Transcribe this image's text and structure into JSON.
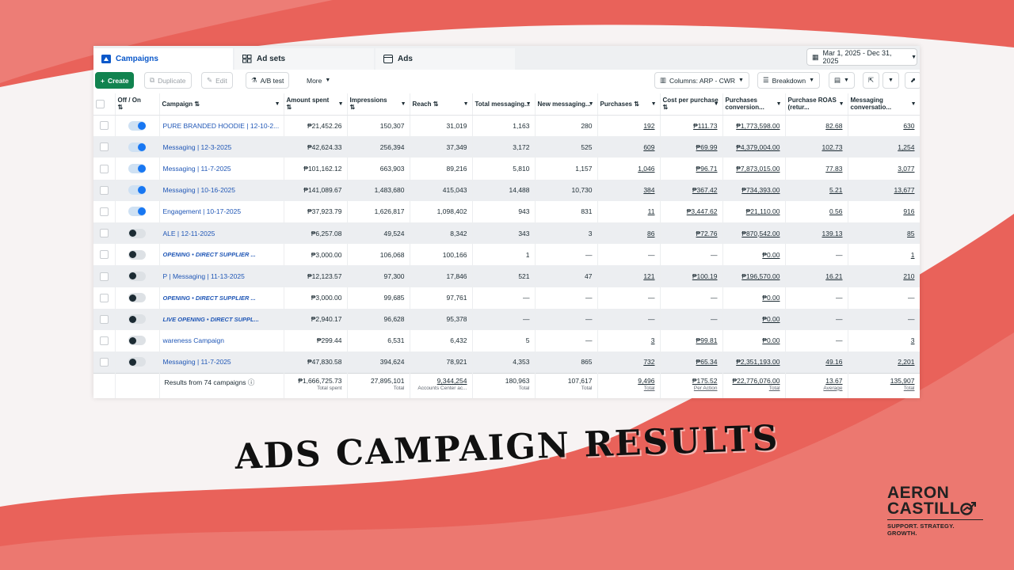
{
  "colors": {
    "accent": "#1877f2",
    "create_green": "#11834f",
    "link_blue": "#2057b6",
    "background_red": "#e8625a"
  },
  "tabs": [
    {
      "label": "Campaigns",
      "icon": "folder-icon",
      "active": true
    },
    {
      "label": "Ad sets",
      "icon": "grid-icon",
      "active": false
    },
    {
      "label": "Ads",
      "icon": "ad-card-icon",
      "active": false
    }
  ],
  "date_range": "Mar 1, 2025 - Dec 31, 2025",
  "toolbar": {
    "create": "Create",
    "duplicate": "Duplicate",
    "edit": "Edit",
    "ab_test": "A/B test",
    "more": "More",
    "columns": "Columns: ARP - CWR",
    "breakdown": "Breakdown"
  },
  "table": {
    "headers": {
      "toggle": "Off / On",
      "campaign": "Campaign",
      "amount_spent": "Amount spent",
      "impressions": "Impressions",
      "reach": "Reach",
      "total_messaging": "Total messaging...",
      "new_messaging": "New messaging...",
      "purchases": "Purchases",
      "cost_per_purchase": "Cost per purchase",
      "purchases_conversion": "Purchases conversion...",
      "purchase_roas": "Purchase ROAS (retur...",
      "messaging_conversation": "Messaging conversatio..."
    },
    "rows": [
      {
        "on": true,
        "campaign": "PURE BRANDED HOODIE | 12-10-2...",
        "amount": "₱21,452.26",
        "impressions": "150,307",
        "reach": "31,019",
        "total_msg": "1,163",
        "new_msg": "280",
        "purchases": "192",
        "cpp": "₱111.73",
        "conv": "₱1,773,598.00",
        "roas": "82.68",
        "msg_conv": "630"
      },
      {
        "on": true,
        "campaign": "Messaging | 12-3-2025",
        "amount": "₱42,624.33",
        "impressions": "256,394",
        "reach": "37,349",
        "total_msg": "3,172",
        "new_msg": "525",
        "purchases": "609",
        "cpp": "₱69.99",
        "conv": "₱4,379,004.00",
        "roas": "102.73",
        "msg_conv": "1,254"
      },
      {
        "on": true,
        "campaign": "Messaging | 11-7-2025",
        "amount": "₱101,162.12",
        "impressions": "663,903",
        "reach": "89,216",
        "total_msg": "5,810",
        "new_msg": "1,157",
        "purchases": "1,046",
        "cpp": "₱96.71",
        "conv": "₱7,873,015.00",
        "roas": "77.83",
        "msg_conv": "3,077"
      },
      {
        "on": true,
        "campaign": "Messaging | 10-16-2025",
        "amount": "₱141,089.67",
        "impressions": "1,483,680",
        "reach": "415,043",
        "total_msg": "14,488",
        "new_msg": "10,730",
        "purchases": "384",
        "cpp": "₱367.42",
        "conv": "₱734,393.00",
        "roas": "5.21",
        "msg_conv": "13,677"
      },
      {
        "on": true,
        "campaign": "Engagement | 10-17-2025",
        "amount": "₱37,923.79",
        "impressions": "1,626,817",
        "reach": "1,098,402",
        "total_msg": "943",
        "new_msg": "831",
        "purchases": "11",
        "cpp": "₱3,447.62",
        "conv": "₱21,110.00",
        "roas": "0.56",
        "msg_conv": "916"
      },
      {
        "on": false,
        "campaign": "ALE | 12-11-2025",
        "amount": "₱6,257.08",
        "impressions": "49,524",
        "reach": "8,342",
        "total_msg": "343",
        "new_msg": "3",
        "purchases": "86",
        "cpp": "₱72.76",
        "conv": "₱870,542.00",
        "roas": "139.13",
        "msg_conv": "85"
      },
      {
        "on": false,
        "campaign": "OPENING • DIRECT SUPPLIER ...",
        "bold": true,
        "amount": "₱3,000.00",
        "impressions": "106,068",
        "reach": "100,166",
        "total_msg": "1",
        "new_msg": "—",
        "purchases": "—",
        "cpp": "—",
        "conv": "₱0.00",
        "roas": "—",
        "msg_conv": "1"
      },
      {
        "on": false,
        "campaign": "P | Messaging | 11-13-2025",
        "amount": "₱12,123.57",
        "impressions": "97,300",
        "reach": "17,846",
        "total_msg": "521",
        "new_msg": "47",
        "purchases": "121",
        "cpp": "₱100.19",
        "conv": "₱196,570.00",
        "roas": "16.21",
        "msg_conv": "210"
      },
      {
        "on": false,
        "campaign": "OPENING • DIRECT SUPPLIER ...",
        "bold": true,
        "amount": "₱3,000.00",
        "impressions": "99,685",
        "reach": "97,761",
        "total_msg": "—",
        "new_msg": "—",
        "purchases": "—",
        "cpp": "—",
        "conv": "₱0.00",
        "roas": "—",
        "msg_conv": "—"
      },
      {
        "on": false,
        "campaign": "LIVE OPENING • DIRECT SUPPL...",
        "bold": true,
        "amount": "₱2,940.17",
        "impressions": "96,628",
        "reach": "95,378",
        "total_msg": "—",
        "new_msg": "—",
        "purchases": "—",
        "cpp": "—",
        "conv": "₱0.00",
        "roas": "—",
        "msg_conv": "—"
      },
      {
        "on": false,
        "campaign": "wareness Campaign",
        "amount": "₱299.44",
        "impressions": "6,531",
        "reach": "6,432",
        "total_msg": "5",
        "new_msg": "—",
        "purchases": "3",
        "cpp": "₱99.81",
        "conv": "₱0.00",
        "roas": "—",
        "msg_conv": "3"
      },
      {
        "on": false,
        "campaign": "Messaging | 11-7-2025",
        "amount": "₱47,830.58",
        "impressions": "394,624",
        "reach": "78,921",
        "total_msg": "4,353",
        "new_msg": "865",
        "purchases": "732",
        "cpp": "₱65.34",
        "conv": "₱2,351,193.00",
        "roas": "49.16",
        "msg_conv": "2,201"
      }
    ],
    "footer": {
      "results_label": "Results from 74 campaigns",
      "amount": "₱1,666,725.73",
      "amount_sub": "Total spent",
      "impressions": "27,895,101",
      "impressions_sub": "Total",
      "reach": "9,344,254",
      "reach_sub": "Accounts Center ac...",
      "total_msg": "180,963",
      "total_msg_sub": "Total",
      "new_msg": "107,617",
      "new_msg_sub": "Total",
      "purchases": "9,496",
      "purchases_sub": "Total",
      "cpp": "₱175.52",
      "cpp_sub": "Per Action",
      "conv": "₱22,776,076.00",
      "conv_sub": "Total",
      "roas": "13.67",
      "roas_sub": "Average",
      "msg_conv": "135,907",
      "msg_conv_sub": "Total"
    }
  },
  "headline": "ADS CAMPAIGN RESULTS",
  "logo": {
    "line1": "AERON",
    "line2": "CASTILL",
    "tagline": "SUPPORT. STRATEGY. GROWTH."
  }
}
